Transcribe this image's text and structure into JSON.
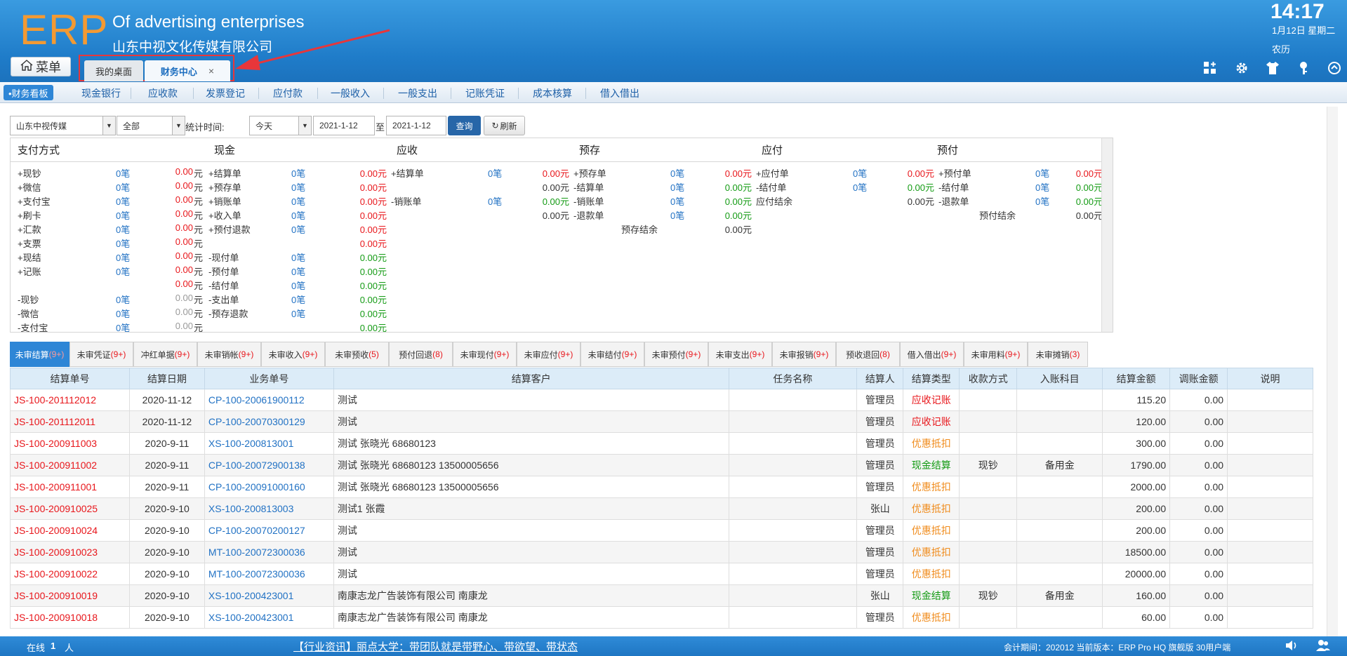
{
  "header": {
    "logo": "ERP",
    "company_en": "Of advertising enterprises",
    "company_cn": "山东中视文化传媒有限公司",
    "time": "14:17",
    "date": "1月12日 星期二",
    "lunar": "农历",
    "menu_label": "菜单",
    "tabs": [
      {
        "label": "我的桌面"
      },
      {
        "label": "财务中心",
        "close": "×"
      }
    ]
  },
  "nav": {
    "active": "•财务看板",
    "items": [
      "现金银行",
      "应收款",
      "发票登记",
      "应付款",
      "一般收入",
      "一般支出",
      "记账凭证",
      "成本核算",
      "借入借出"
    ]
  },
  "filter": {
    "company": "山东中视传媒",
    "scope": "全部",
    "label_time": "统计时间:",
    "period": "今天",
    "date_from": "2021-1-12",
    "to_label": "至",
    "date_to": "2021-1-12",
    "query": "查询",
    "refresh": "刷新"
  },
  "summary": {
    "headers": [
      "支付方式",
      "现金",
      "应收",
      "预存",
      "应付",
      "预付"
    ],
    "payment": [
      {
        "label": "+现钞",
        "count": "0笔",
        "amt": "0.00",
        "unit": "元"
      },
      {
        "label": "+微信",
        "count": "0笔",
        "amt": "0.00",
        "unit": "元"
      },
      {
        "label": "+支付宝",
        "count": "0笔",
        "amt": "0.00",
        "unit": "元"
      },
      {
        "label": "+刷卡",
        "count": "0笔",
        "amt": "0.00",
        "unit": "元"
      },
      {
        "label": "+汇款",
        "count": "0笔",
        "amt": "0.00",
        "unit": "元"
      },
      {
        "label": "+支票",
        "count": "0笔",
        "amt": "0.00",
        "unit": "元"
      },
      {
        "label": "+现结",
        "count": "0笔",
        "amt": "0.00",
        "unit": "元"
      },
      {
        "label": "+记账",
        "count": "0笔",
        "amt": "0.00",
        "unit": "元"
      },
      {
        "label": "",
        "count": "",
        "amt": "0.00",
        "unit": "元"
      },
      {
        "label": "-现钞",
        "count": "0笔",
        "amt": "0.00",
        "unit": "元"
      },
      {
        "label": "-微信",
        "count": "0笔",
        "amt": "0.00",
        "unit": "元"
      },
      {
        "label": "-支付宝",
        "count": "0笔",
        "amt": "0.00",
        "unit": "元"
      }
    ],
    "cash": [
      {
        "label": "+结算单",
        "count": "0笔",
        "amt": "0.00元"
      },
      {
        "label": "+预存单",
        "count": "0笔",
        "amt": "0.00元"
      },
      {
        "label": "+销账单",
        "count": "0笔",
        "amt": "0.00元"
      },
      {
        "label": "+收入单",
        "count": "0笔",
        "amt": "0.00元"
      },
      {
        "label": "+预付退款",
        "count": "0笔",
        "amt": "0.00元"
      },
      {
        "label": "",
        "count": "",
        "amt": "0.00元"
      },
      {
        "label": "-现付单",
        "count": "0笔",
        "amt": "0.00元"
      },
      {
        "label": "-预付单",
        "count": "0笔",
        "amt": "0.00元"
      },
      {
        "label": "-结付单",
        "count": "0笔",
        "amt": "0.00元"
      },
      {
        "label": "-支出单",
        "count": "0笔",
        "amt": "0.00元"
      },
      {
        "label": "-预存退款",
        "count": "0笔",
        "amt": "0.00元"
      },
      {
        "label": "",
        "count": "",
        "amt": "0.00元"
      }
    ],
    "ar": [
      {
        "label": "+结算单",
        "count": "0笔",
        "amt": "0.00元"
      },
      {
        "label": "",
        "count": "",
        "amt": "0.00元"
      },
      {
        "label": "-销账单",
        "count": "0笔",
        "amt": "0.00元"
      },
      {
        "label": "",
        "count": "",
        "amt": "0.00元"
      }
    ],
    "prestore": [
      {
        "label": "+预存单",
        "count": "0笔",
        "amt": "0.00元"
      },
      {
        "label": "-结算单",
        "count": "0笔",
        "amt": "0.00元"
      },
      {
        "label": "-销账单",
        "count": "0笔",
        "amt": "0.00元"
      },
      {
        "label": "-退款单",
        "count": "0笔",
        "amt": "0.00元"
      },
      {
        "label": "预存结余",
        "count": "",
        "amt": "0.00元"
      }
    ],
    "ap": [
      {
        "label": "+应付单",
        "count": "0笔",
        "amt": "0.00元"
      },
      {
        "label": "-结付单",
        "count": "0笔",
        "amt": "0.00元"
      },
      {
        "label": "应付结余",
        "count": "",
        "amt": "0.00元"
      }
    ],
    "prepay": [
      {
        "label": "+预付单",
        "count": "0笔",
        "amt": "0.00元"
      },
      {
        "label": "-结付单",
        "count": "0笔",
        "amt": "0.00元"
      },
      {
        "label": "-退款单",
        "count": "0笔",
        "amt": "0.00元"
      },
      {
        "label": "预付结余",
        "count": "",
        "amt": "0.00元"
      }
    ]
  },
  "subtabs": [
    {
      "label": "未审结算",
      "count": "(9+)"
    },
    {
      "label": "未审凭证",
      "count": "(9+)"
    },
    {
      "label": "冲红单据",
      "count": "(9+)"
    },
    {
      "label": "未审销帐",
      "count": "(9+)"
    },
    {
      "label": "未审收入",
      "count": "(9+)"
    },
    {
      "label": "未审预收",
      "count": "(5)"
    },
    {
      "label": "预付回退",
      "count": "(8)"
    },
    {
      "label": "未审现付",
      "count": "(9+)"
    },
    {
      "label": "未审应付",
      "count": "(9+)"
    },
    {
      "label": "未审结付",
      "count": "(9+)"
    },
    {
      "label": "未审预付",
      "count": "(9+)"
    },
    {
      "label": "未审支出",
      "count": "(9+)"
    },
    {
      "label": "未审报销",
      "count": "(9+)"
    },
    {
      "label": "预收退回",
      "count": "(8)"
    },
    {
      "label": "借入借出",
      "count": "(9+)"
    },
    {
      "label": "未审用料",
      "count": "(9+)"
    },
    {
      "label": "未审摊销",
      "count": "(3)"
    }
  ],
  "table": {
    "columns": [
      "结算单号",
      "结算日期",
      "业务单号",
      "结算客户",
      "任务名称",
      "结算人",
      "结算类型",
      "收款方式",
      "入账科目",
      "结算金额",
      "调账金额",
      "说明"
    ],
    "rows": [
      {
        "no": "JS-100-201112012",
        "date": "2020-11-12",
        "biz": "CP-100-20061900112",
        "customer": "测试",
        "task": "",
        "person": "管理员",
        "type": "应收记账",
        "tcolor": "red",
        "pay": "",
        "account": "",
        "amount": "115.20",
        "adjust": "0.00",
        "note": ""
      },
      {
        "no": "JS-100-201112011",
        "date": "2020-11-12",
        "biz": "CP-100-20070300129",
        "customer": "测试",
        "task": "",
        "person": "管理员",
        "type": "应收记账",
        "tcolor": "red",
        "pay": "",
        "account": "",
        "amount": "120.00",
        "adjust": "0.00",
        "note": ""
      },
      {
        "no": "JS-100-200911003",
        "date": "2020-9-11",
        "biz": "XS-100-200813001",
        "customer": "测试 张晓光 68680123",
        "task": "",
        "person": "管理员",
        "type": "优惠抵扣",
        "tcolor": "orange",
        "pay": "",
        "account": "",
        "amount": "300.00",
        "adjust": "0.00",
        "note": ""
      },
      {
        "no": "JS-100-200911002",
        "date": "2020-9-11",
        "biz": "CP-100-20072900138",
        "customer": "测试 张晓光 68680123 13500005656",
        "task": "",
        "person": "管理员",
        "type": "现金结算",
        "tcolor": "green",
        "pay": "现钞",
        "account": "备用金",
        "amount": "1790.00",
        "adjust": "0.00",
        "note": ""
      },
      {
        "no": "JS-100-200911001",
        "date": "2020-9-11",
        "biz": "CP-100-20091000160",
        "customer": "测试 张晓光 68680123 13500005656",
        "task": "",
        "person": "管理员",
        "type": "优惠抵扣",
        "tcolor": "orange",
        "pay": "",
        "account": "",
        "amount": "2000.00",
        "adjust": "0.00",
        "note": ""
      },
      {
        "no": "JS-100-200910025",
        "date": "2020-9-10",
        "biz": "XS-100-200813003",
        "customer": "测试1 张霞",
        "task": "",
        "person": "张山",
        "type": "优惠抵扣",
        "tcolor": "orange",
        "pay": "",
        "account": "",
        "amount": "200.00",
        "adjust": "0.00",
        "note": ""
      },
      {
        "no": "JS-100-200910024",
        "date": "2020-9-10",
        "biz": "CP-100-20070200127",
        "customer": "测试",
        "task": "",
        "person": "管理员",
        "type": "优惠抵扣",
        "tcolor": "orange",
        "pay": "",
        "account": "",
        "amount": "200.00",
        "adjust": "0.00",
        "note": ""
      },
      {
        "no": "JS-100-200910023",
        "date": "2020-9-10",
        "biz": "MT-100-20072300036",
        "customer": "测试",
        "task": "",
        "person": "管理员",
        "type": "优惠抵扣",
        "tcolor": "orange",
        "pay": "",
        "account": "",
        "amount": "18500.00",
        "adjust": "0.00",
        "note": ""
      },
      {
        "no": "JS-100-200910022",
        "date": "2020-9-10",
        "biz": "MT-100-20072300036",
        "customer": "测试",
        "task": "",
        "person": "管理员",
        "type": "优惠抵扣",
        "tcolor": "orange",
        "pay": "",
        "account": "",
        "amount": "20000.00",
        "adjust": "0.00",
        "note": ""
      },
      {
        "no": "JS-100-200910019",
        "date": "2020-9-10",
        "biz": "XS-100-200423001",
        "customer": "南康志龙广告装饰有限公司 南康龙",
        "task": "",
        "person": "张山",
        "type": "现金结算",
        "tcolor": "green",
        "pay": "现钞",
        "account": "备用金",
        "amount": "160.00",
        "adjust": "0.00",
        "note": ""
      },
      {
        "no": "JS-100-200910018",
        "date": "2020-9-10",
        "biz": "XS-100-200423001",
        "customer": "南康志龙广告装饰有限公司 南康龙",
        "task": "",
        "person": "管理员",
        "type": "优惠抵扣",
        "tcolor": "orange",
        "pay": "",
        "account": "",
        "amount": "60.00",
        "adjust": "0.00",
        "note": ""
      }
    ]
  },
  "footer": {
    "online_label": "在线",
    "online_count": "1",
    "online_unit": "人",
    "news": "【行业资讯】丽点大学：带团队就是带野心、带欲望、带状态",
    "version": "会计期间：202012 当前版本：ERP Pro HQ 旗舰版 30用户端"
  }
}
